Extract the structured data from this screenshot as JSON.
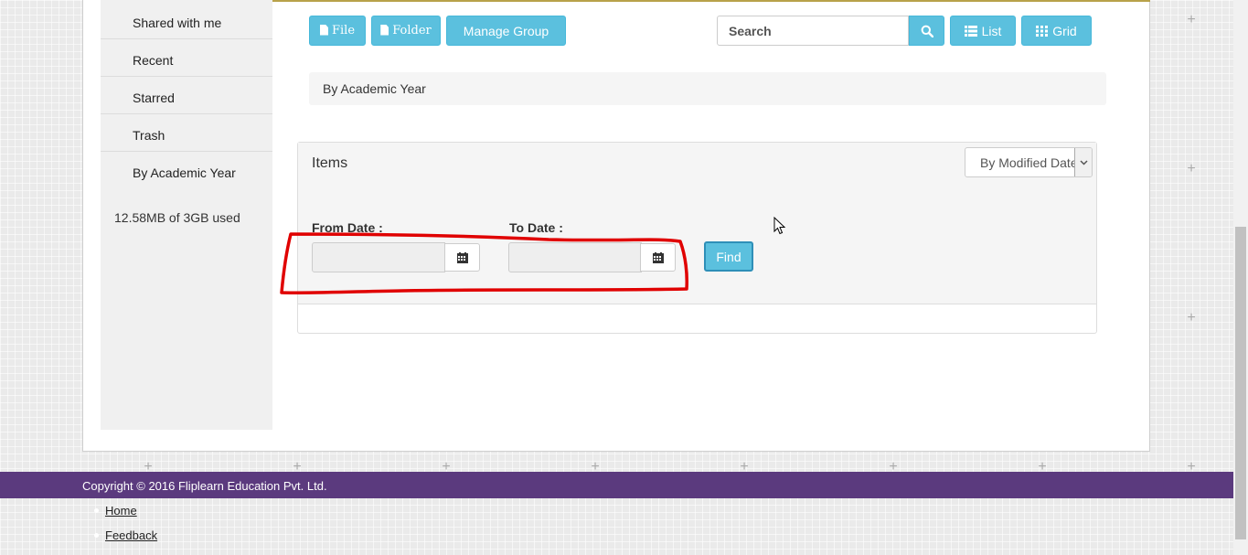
{
  "sidebar": {
    "items": [
      {
        "label": "Shared with me"
      },
      {
        "label": "Recent"
      },
      {
        "label": "Starred"
      },
      {
        "label": "Trash"
      },
      {
        "label": "By Academic Year"
      }
    ],
    "usage": "12.58MB of 3GB used"
  },
  "toolbar": {
    "file_label": "File",
    "folder_label": "Folder",
    "manage_group_label": "Manage Group",
    "search_placeholder": "Search",
    "list_label": "List",
    "grid_label": "Grid"
  },
  "breadcrumb": {
    "current": "By Academic Year"
  },
  "items_panel": {
    "title": "Items",
    "sort_selected": "By Modified Date",
    "from_date_label": "From Date :",
    "to_date_label": "To Date :",
    "find_label": "Find",
    "from_date_value": "",
    "to_date_value": ""
  },
  "footer": {
    "copyright": "Copyright © 2016 Fliplearn Education Pvt. Ltd.",
    "links": [
      "Home",
      "Feedback"
    ]
  },
  "colors": {
    "accent": "#5bc0de",
    "footer_bg": "#5b3a7e",
    "annotation_red": "#e00000"
  }
}
